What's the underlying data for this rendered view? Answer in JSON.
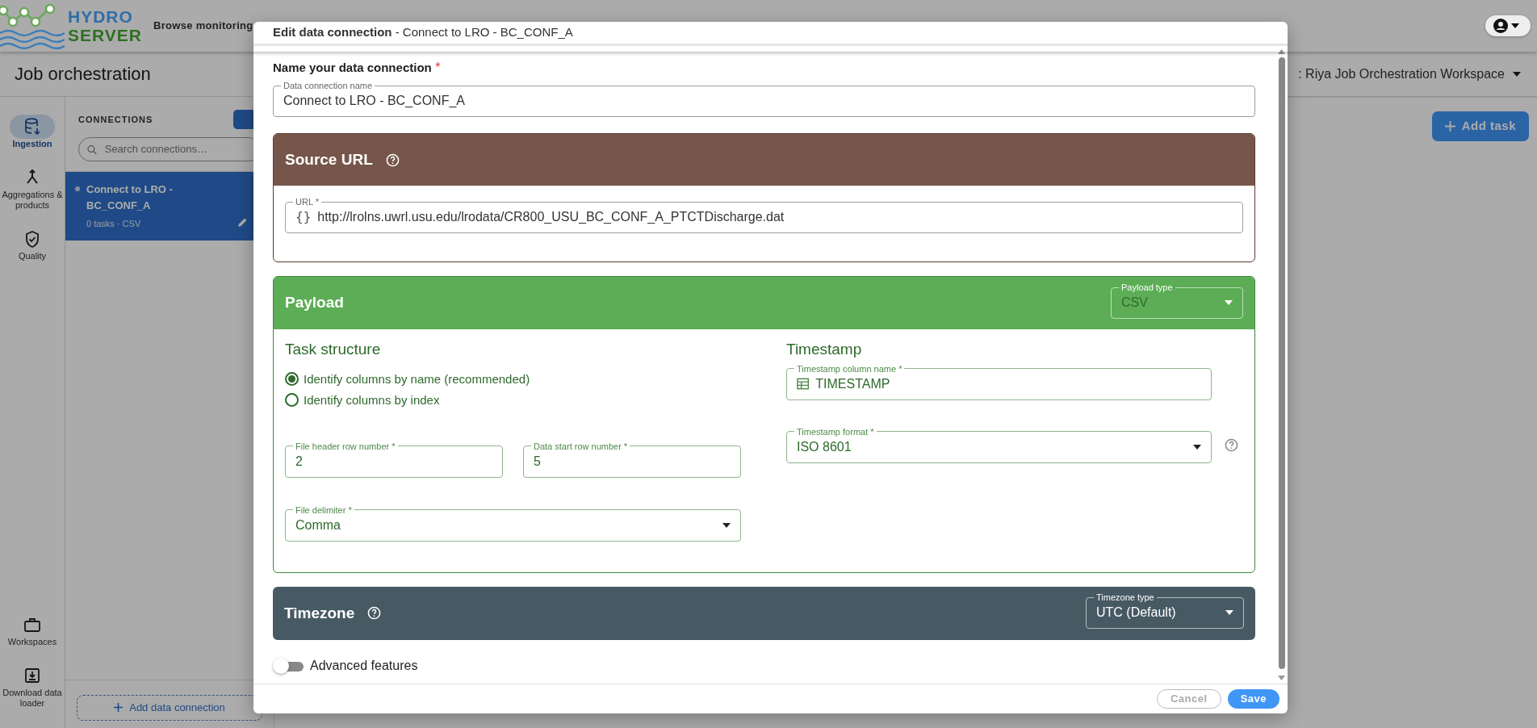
{
  "app_header": {
    "logo_top": "HYDRO",
    "logo_bottom": "SERVER",
    "tagline": "Browse monitoring"
  },
  "page_title": "Job orchestration",
  "workspace_selector": {
    "value": ": Riya Job Orchestration Workspace"
  },
  "nav_rail": [
    {
      "label": "Ingestion",
      "selected": true
    },
    {
      "label": "Aggregations & products",
      "selected": false
    },
    {
      "label": "Quality",
      "selected": false
    },
    {
      "label": "Workspaces",
      "selected": false
    },
    {
      "label": "Download data loader",
      "selected": false
    }
  ],
  "connections": {
    "heading": "CONNECTIONS",
    "search_placeholder": "Search connections…",
    "items": [
      {
        "name": "Connect to LRO - BC_CONF_A",
        "meta": "0 tasks · CSV",
        "selected": true
      }
    ],
    "add_button": "Add data connection"
  },
  "add_task_button": "Add task",
  "dialog": {
    "title": "**Edit data connection** - Connect to LRO - BC_CONF_A",
    "name_section": {
      "label": "Name your data connection",
      "required_mark": "*",
      "field_label": "Data connection name",
      "value": "Connect to LRO - BC_CONF_A"
    },
    "source": {
      "title": "Source URL",
      "field_label": "URL *",
      "prefix_icon": "{}",
      "value": "http://lrolns.uwrl.usu.edu/lrodata/CR800_USU_BC_CONF_A_PTCTDischarge.dat"
    },
    "payload": {
      "title": "Payload",
      "type_label": "Payload type",
      "type_value": "CSV",
      "task_structure": {
        "heading": "Task structure",
        "options": [
          {
            "label": "Identify columns by name (recommended)",
            "selected": true
          },
          {
            "label": "Identify columns by index",
            "selected": false
          }
        ],
        "header_row": {
          "label": "File header row number *",
          "value": "2"
        },
        "data_start_row": {
          "label": "Data start row number *",
          "value": "5"
        },
        "delimiter": {
          "label": "File delimiter *",
          "value": "Comma"
        }
      },
      "timestamp": {
        "heading": "Timestamp",
        "column_name": {
          "label": "Timestamp column name *",
          "value": "TIMESTAMP"
        },
        "format": {
          "label": "Timestamp format *",
          "value": "ISO 8601"
        }
      }
    },
    "timezone": {
      "title": "Timezone",
      "type_label": "Timezone type",
      "type_value": "UTC (Default)"
    },
    "advanced": {
      "label": "Advanced features",
      "on": false
    },
    "buttons": [
      {
        "label": "Cancel",
        "kind": "secondary"
      },
      {
        "label": "Save",
        "kind": "primary"
      }
    ]
  }
}
